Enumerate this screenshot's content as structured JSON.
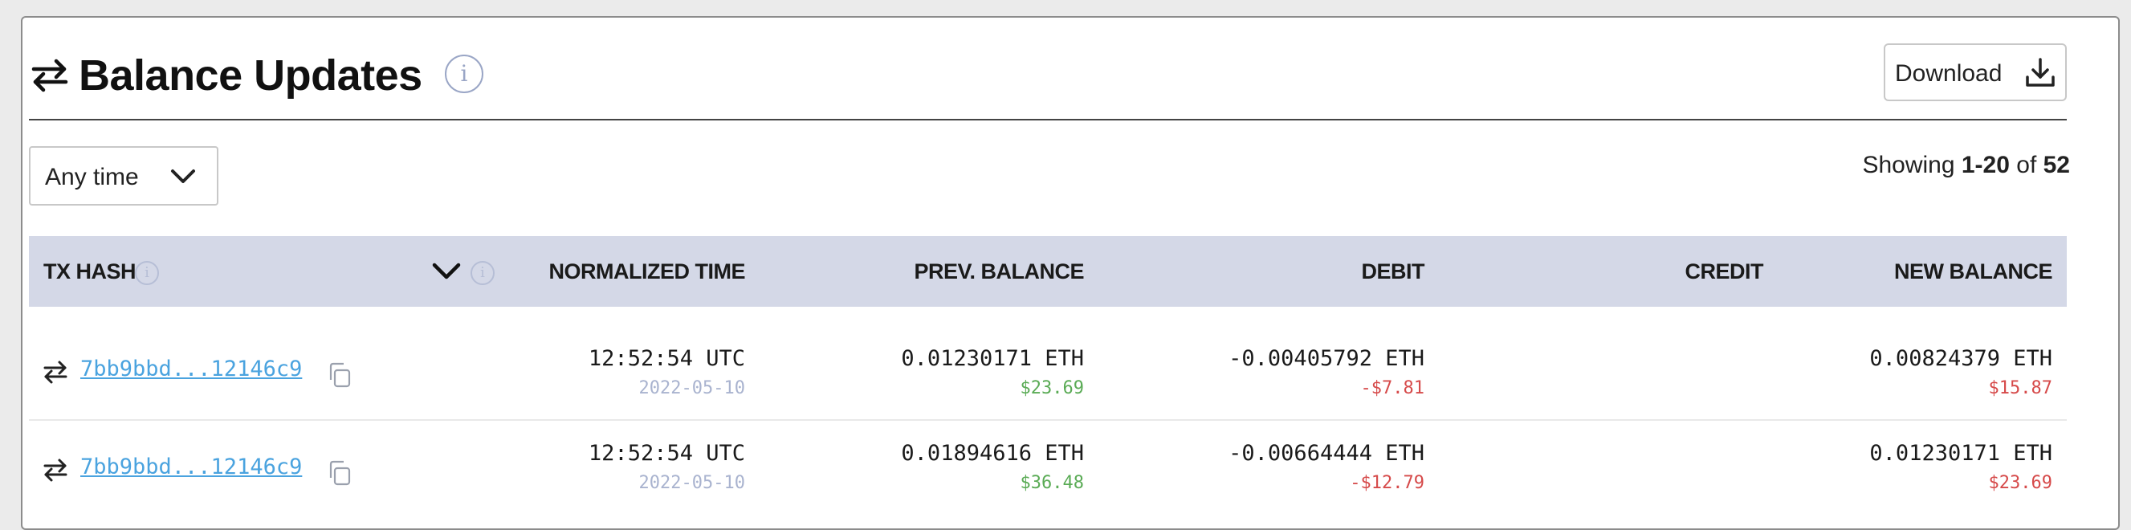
{
  "header": {
    "title": "Balance Updates",
    "info_glyph": "i",
    "title_icon": "transfer-arrows-icon",
    "download_label": "Download",
    "download_icon": "download-icon"
  },
  "filter": {
    "label": "Any time",
    "icon": "chevron-down-icon"
  },
  "pagination": {
    "prefix": "Showing ",
    "range": "1-20",
    "of": " of ",
    "total": "52"
  },
  "table": {
    "columns": [
      "TX HASH",
      "NORMALIZED TIME",
      "PREV. BALANCE",
      "DEBIT",
      "CREDIT",
      "NEW BALANCE"
    ],
    "info_glyph": "i",
    "rows": [
      {
        "tx_hash": "7bb9bbd...12146c9",
        "time": "12:52:54 UTC",
        "date": "2022-05-10",
        "prev_balance": "0.01230171 ETH",
        "prev_balance_usd": "$23.69",
        "debit": "-0.00405792 ETH",
        "debit_usd": "-$7.81",
        "credit": "",
        "new_balance": "0.00824379 ETH",
        "new_balance_usd": "$15.87"
      },
      {
        "tx_hash": "7bb9bbd...12146c9",
        "time": "12:52:54 UTC",
        "date": "2022-05-10",
        "prev_balance": "0.01894616 ETH",
        "prev_balance_usd": "$36.48",
        "debit": "-0.00664444 ETH",
        "debit_usd": "-$12.79",
        "credit": "",
        "new_balance": "0.01230171 ETH",
        "new_balance_usd": "$23.69"
      }
    ]
  },
  "colors": {
    "link": "#4aa3df",
    "positive": "#5aab55",
    "negative": "#d64a4a",
    "table_header_bg": "#d4d8e7",
    "date": "#a9b3cf"
  }
}
